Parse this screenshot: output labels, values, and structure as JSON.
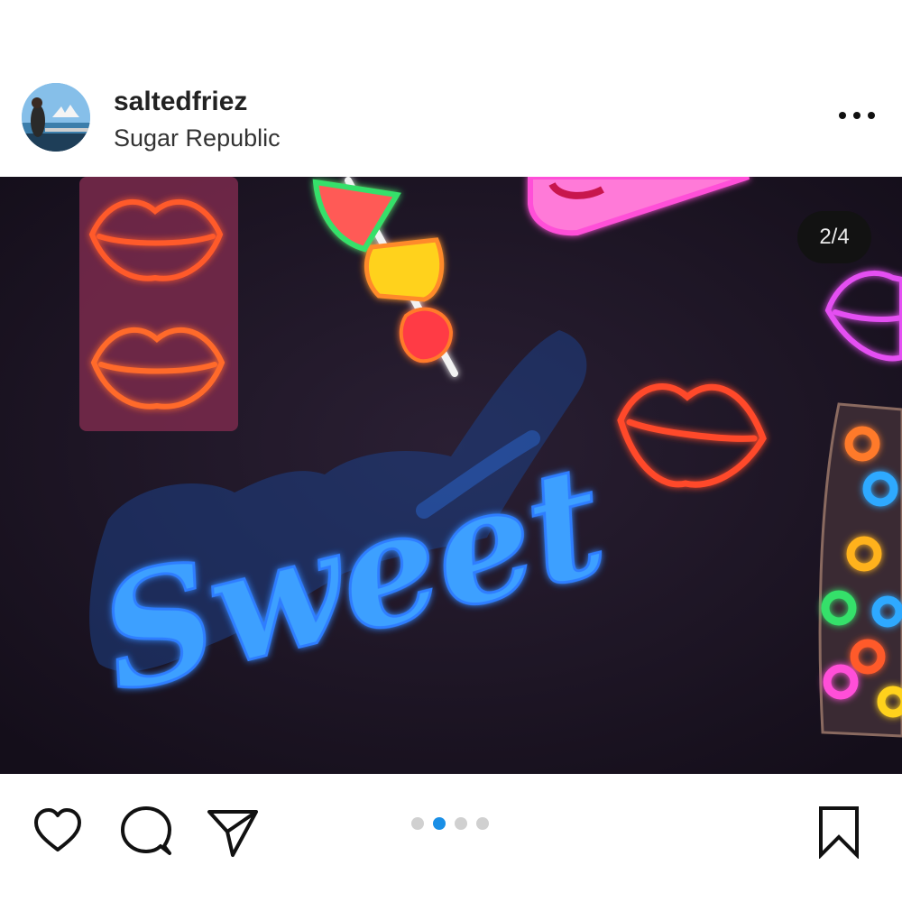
{
  "post": {
    "username": "saltedfriez",
    "location": "Sugar Republic",
    "image_counter": "2/4",
    "image_alt_text": "Sweet",
    "carousel": {
      "total": 4,
      "active_index": 1
    }
  },
  "icons": {
    "more": "more-options-icon",
    "like": "heart-icon",
    "comment": "comment-icon",
    "share": "send-icon",
    "save": "bookmark-icon"
  },
  "colors": {
    "accent": "#1a8fe6",
    "neon_blue": "#2f7dff",
    "neon_red": "#ff4a2a",
    "neon_pink": "#ff4fd8",
    "neon_yellow": "#ffd21f",
    "neon_green": "#36e06a"
  }
}
